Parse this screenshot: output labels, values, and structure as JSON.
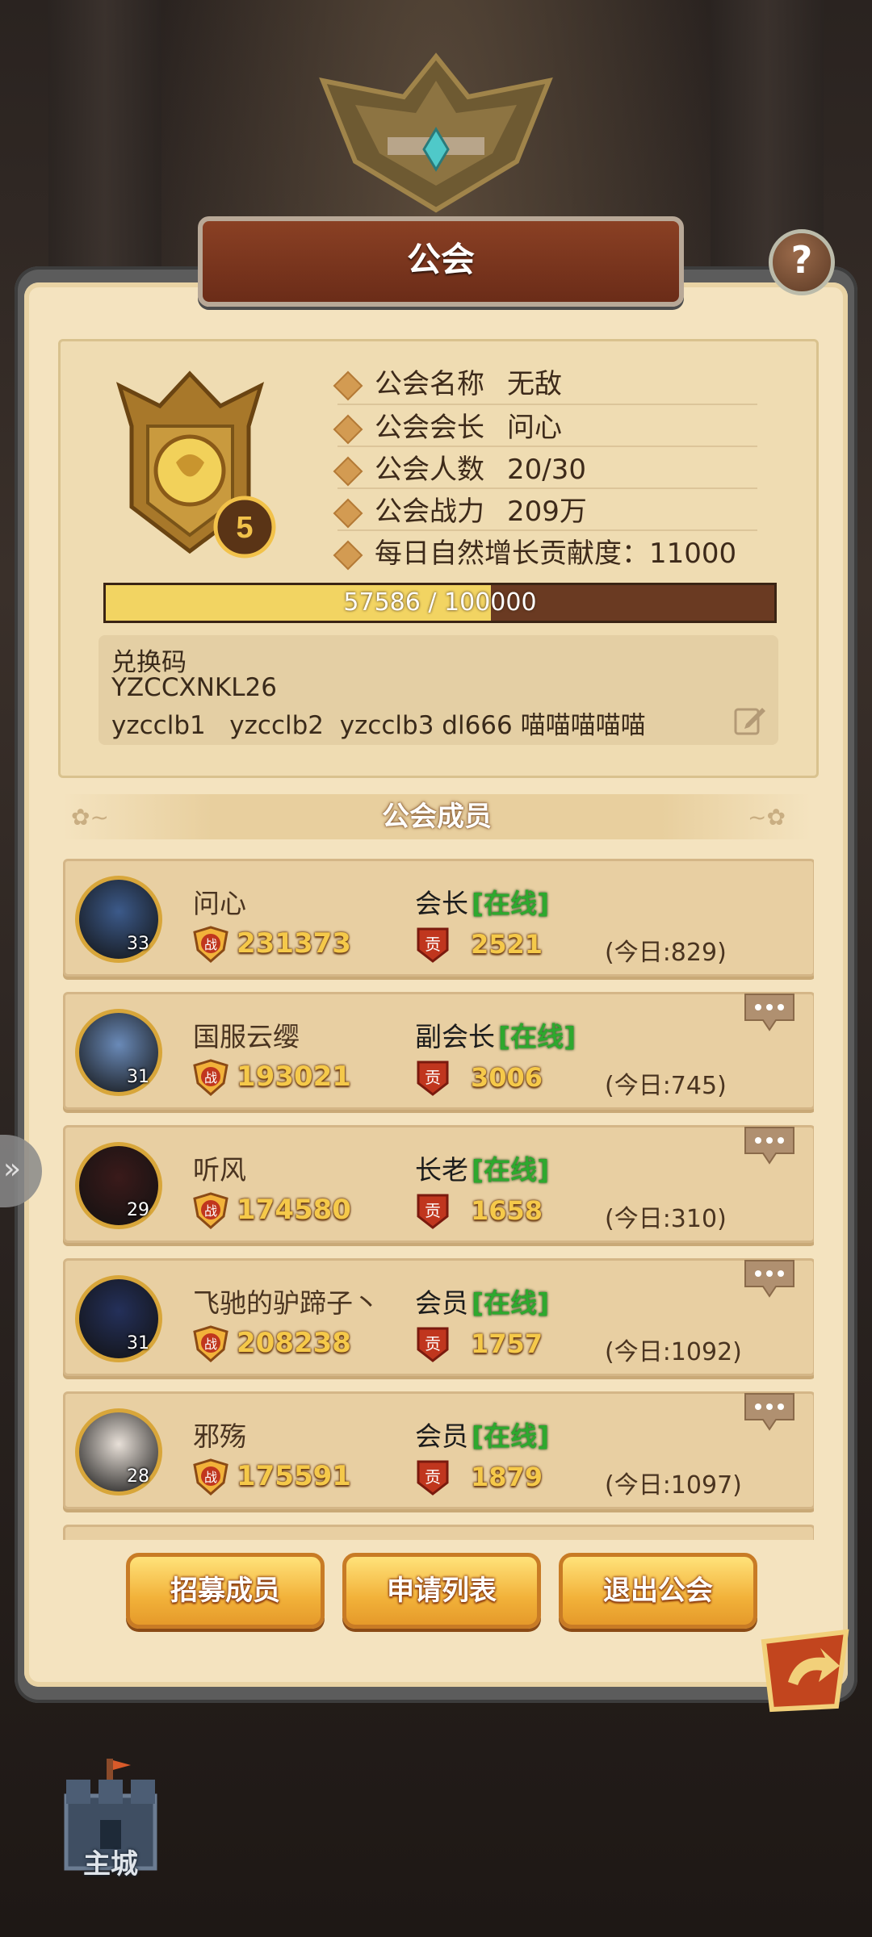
{
  "title": "公会",
  "help_icon": "question-mark-icon",
  "guild": {
    "level": "5",
    "rows": [
      {
        "label": "公会名称",
        "value": "无敌"
      },
      {
        "label": "公会会长",
        "value": "问心"
      },
      {
        "label": "公会人数",
        "value": "20/30"
      },
      {
        "label": "公会战力",
        "value": "209万"
      }
    ],
    "daily_growth": "每日自然增长贡献度：11000",
    "progress_text": "57586 / 100000",
    "progress_fraction": 0.57586,
    "notice_lines": [
      "兑换码",
      "YZCCXNKL26",
      "yzcclb1   yzcclb2  yzcclb3 dl666 喵喵喵喵喵"
    ]
  },
  "members_header": "公会成员",
  "members": [
    {
      "name": "问心",
      "level": "33",
      "power": "231373",
      "role": "会长",
      "status": "[在线]",
      "contrib": "2521",
      "today": "(今日:829)",
      "more": false
    },
    {
      "name": "国服云缨",
      "level": "31",
      "power": "193021",
      "role": "副会长",
      "status": "[在线]",
      "contrib": "3006",
      "today": "(今日:745)",
      "more": true
    },
    {
      "name": "听风",
      "level": "29",
      "power": "174580",
      "role": "长老",
      "status": "[在线]",
      "contrib": "1658",
      "today": "(今日:310)",
      "more": true
    },
    {
      "name": "飞驰的驴蹄子丶",
      "level": "31",
      "power": "208238",
      "role": "会员",
      "status": "[在线]",
      "contrib": "1757",
      "today": "(今日:1092)",
      "more": true
    },
    {
      "name": "邪殇",
      "level": "28",
      "power": "175591",
      "role": "会员",
      "status": "[在线]",
      "contrib": "1879",
      "today": "(今日:1097)",
      "more": true
    }
  ],
  "icons": {
    "power": "战",
    "contrib": "贡"
  },
  "buttons": {
    "recruit": "招募成员",
    "applications": "申请列表",
    "quit": "退出公会"
  },
  "home_label": "主城",
  "colors": {
    "panel": "#f4e3bf",
    "banner": "#7a3520",
    "gold": "#f5c94a",
    "online": "#2ea82e"
  }
}
